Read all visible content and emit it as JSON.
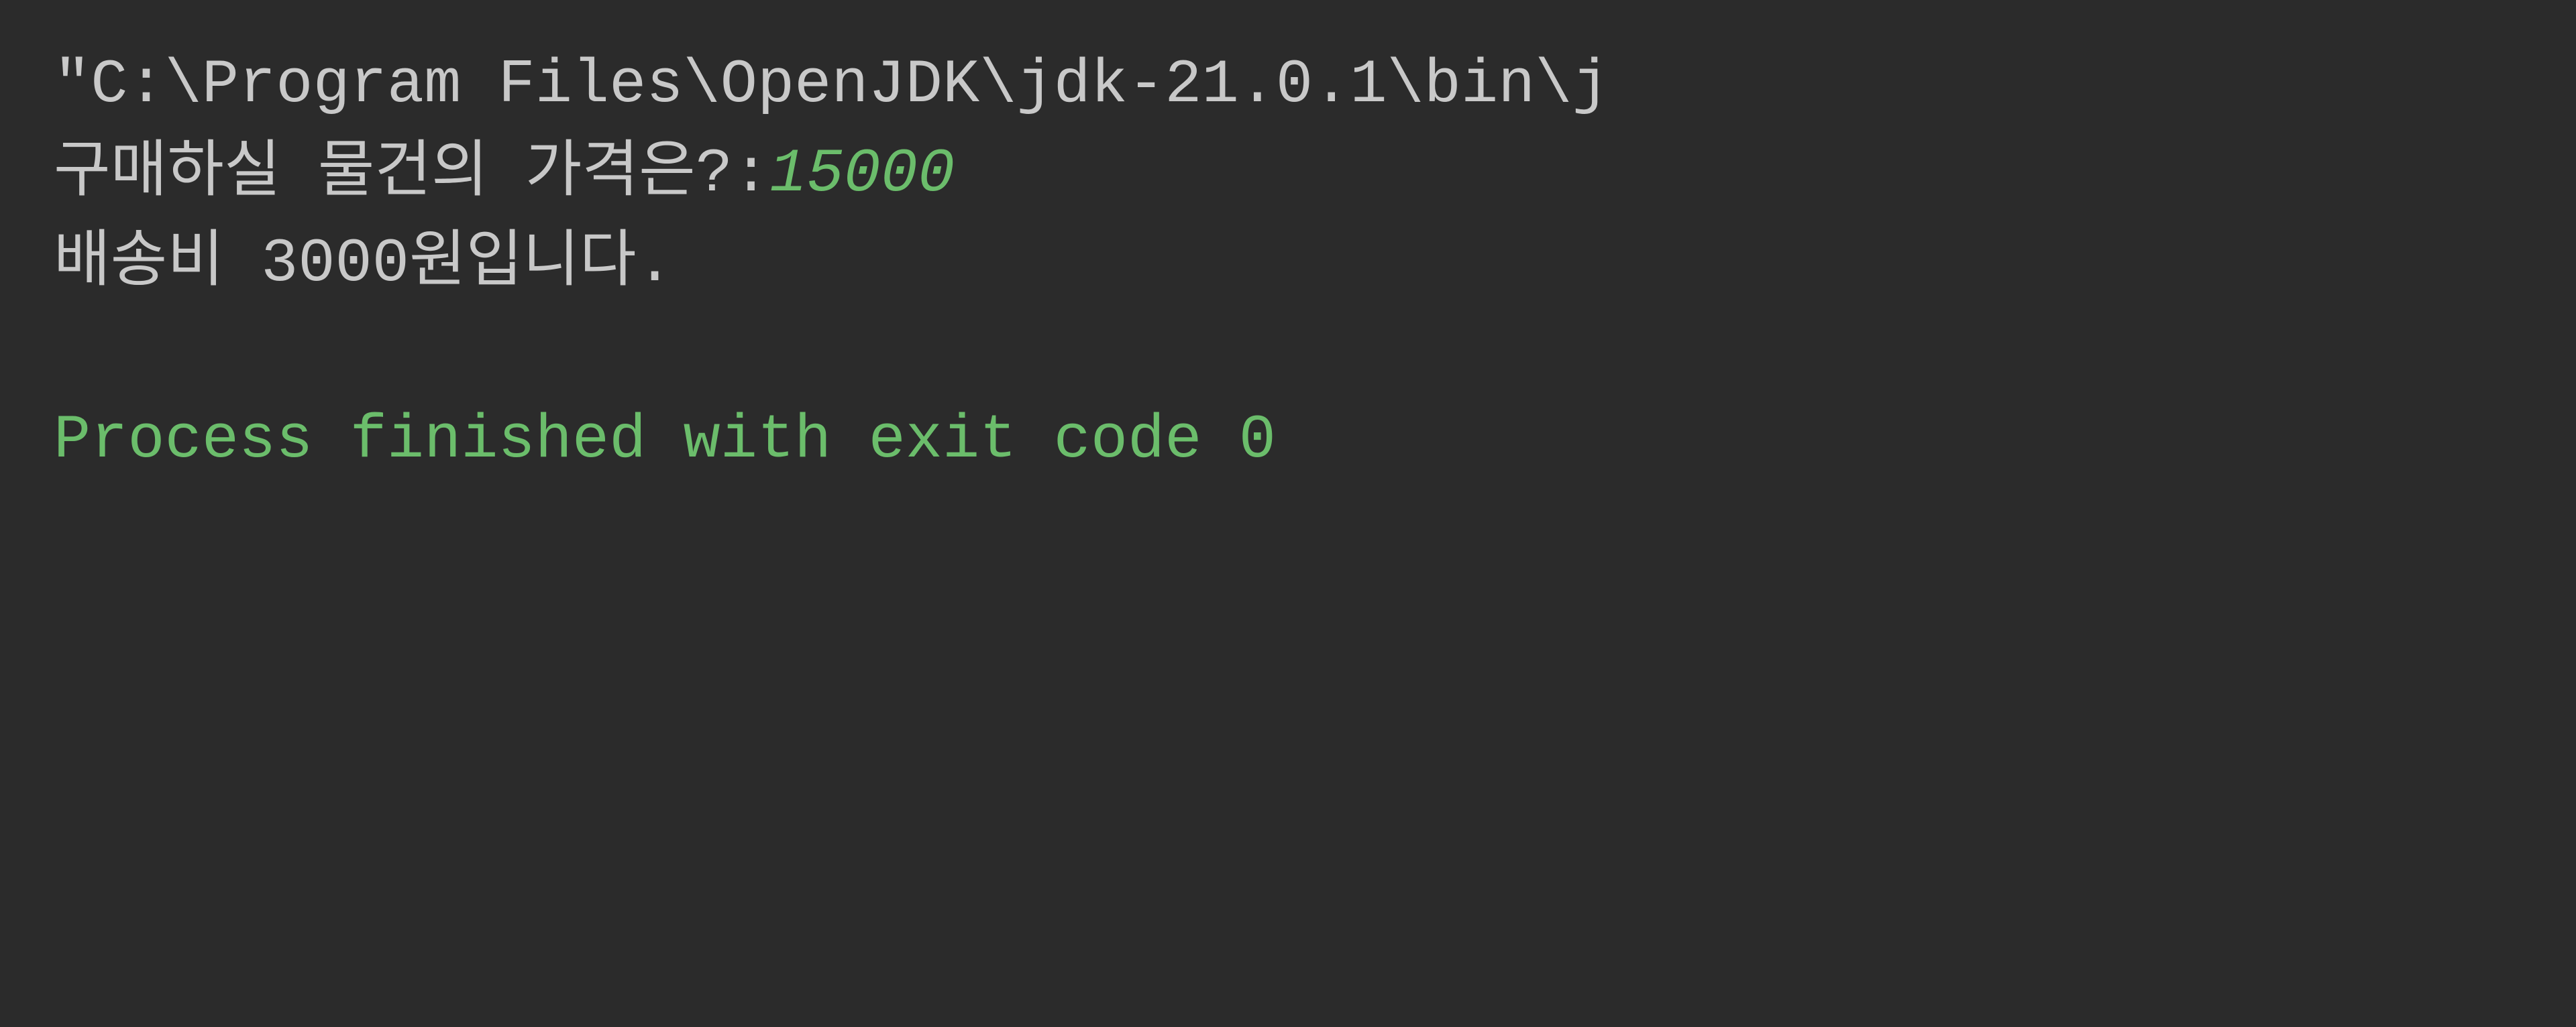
{
  "terminal": {
    "background_color": "#2b2b2b",
    "lines": {
      "command": "\"C:\\Program Files\\OpenJDK\\jdk-21.0.1\\bin\\j",
      "prompt_label": "구매하실 물건의 가격은?:",
      "prompt_input": "15000",
      "output": "배송비 3000원입니다.",
      "process_status": "Process finished with exit code 0"
    }
  }
}
